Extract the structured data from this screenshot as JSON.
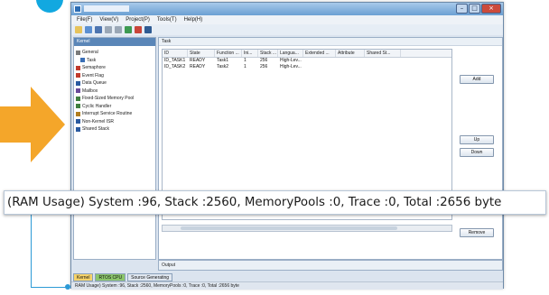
{
  "menu": [
    "File(F)",
    "View(V)",
    "Project(P)",
    "Tools(T)",
    "Help(H)"
  ],
  "left_panel": {
    "header": "Kernel",
    "items": [
      {
        "label": "General",
        "color": "#7a7a7a",
        "indent": false
      },
      {
        "label": "Task",
        "color": "#3b6fb6",
        "indent": true
      },
      {
        "label": "Semaphore",
        "color": "#c0392b",
        "indent": false
      },
      {
        "label": "Event Flag",
        "color": "#c0392b",
        "indent": false
      },
      {
        "label": "Data Queue",
        "color": "#2a5aa0",
        "indent": false
      },
      {
        "label": "Mailbox",
        "color": "#6a4a9a",
        "indent": false
      },
      {
        "label": "Fixed-Sized Memory Pool",
        "color": "#3f7f3f",
        "indent": false
      },
      {
        "label": "Cyclic Handler",
        "color": "#3f7f3f",
        "indent": false
      },
      {
        "label": "Interrupt Service Routine",
        "color": "#b07d1f",
        "indent": false
      },
      {
        "label": "Non-Kernel ISR",
        "color": "#2a5aa0",
        "indent": false
      },
      {
        "label": "Shared Stack",
        "color": "#2a5aa0",
        "indent": false
      }
    ]
  },
  "main": {
    "header": "Task",
    "columns": [
      "ID",
      "State",
      "Function ...",
      "Ini...",
      "Stack ...",
      "Langua...",
      "Extended ...",
      "Attribute",
      "Shared St..."
    ],
    "rows": [
      [
        "ID_TASK1",
        "READY",
        "Task1",
        "1",
        "256",
        "High-Lev..."
      ],
      [
        "ID_TASK2",
        "READY",
        "Task2",
        "1",
        "256",
        "High-Lev..."
      ]
    ],
    "buttons": {
      "add": "Add",
      "up": "Up",
      "down": "Down",
      "remove": "Remove"
    }
  },
  "output_label": "Output",
  "tabs": [
    {
      "label": "Kernel",
      "style": "active"
    },
    {
      "label": "RTOS CPU",
      "style": "green"
    },
    {
      "label": "Source Generating",
      "style": "normal"
    }
  ],
  "statusbar": "RAM Usage) System :96, Stack :2560, MemoryPools :0, Trace :0, Total :2656 byte",
  "callout_text": "(RAM Usage) System :96, Stack :2560, MemoryPools :0, Trace :0, Total :2656 byte",
  "colors": {
    "accent": "#12a8e0",
    "arrow": "#f4a62a",
    "callout_line": "#2d9ad6"
  }
}
